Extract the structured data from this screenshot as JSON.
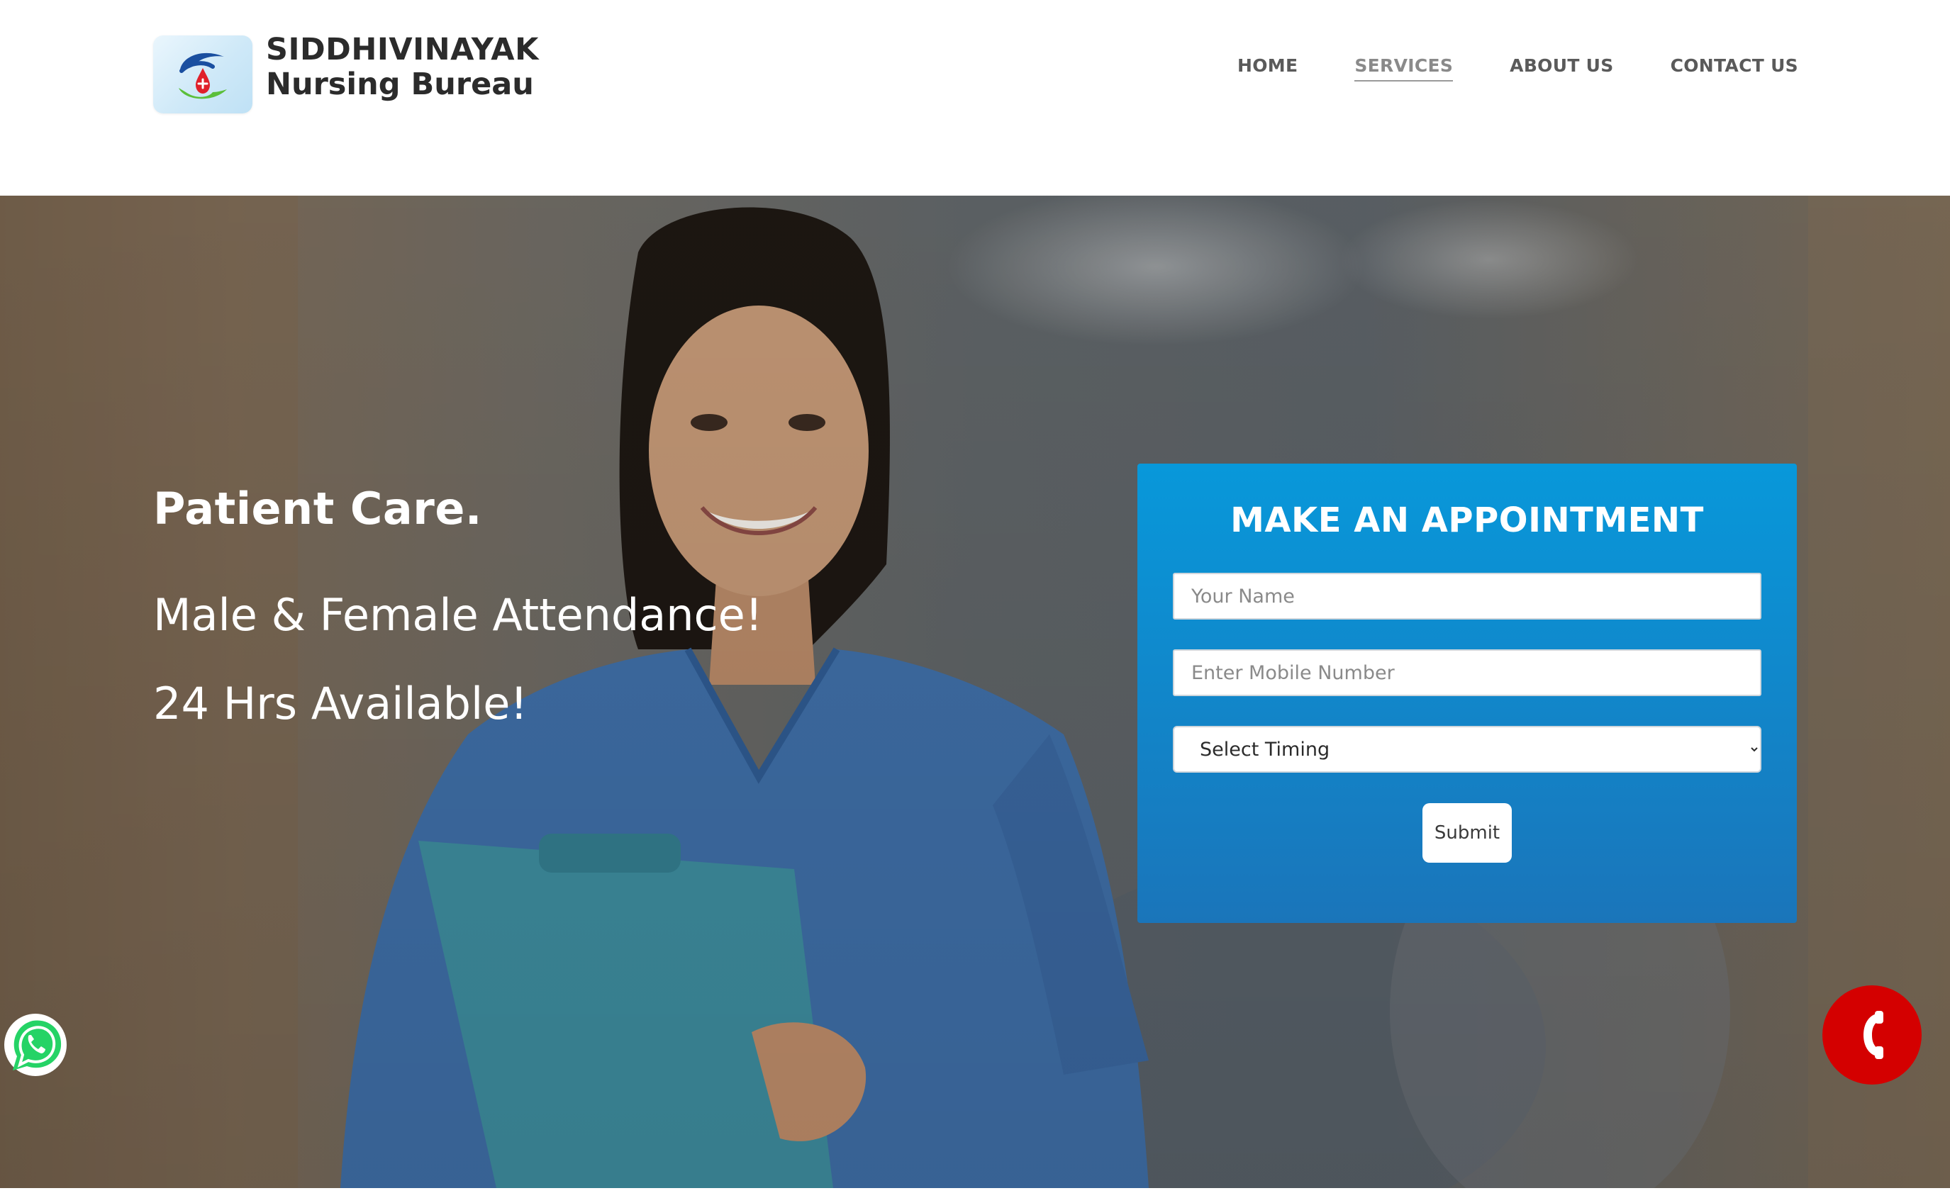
{
  "header": {
    "brand_line1": "SIDDHIVINAYAK",
    "brand_line2": "Nursing Bureau",
    "logo_icon": "hands-blood-drop-logo"
  },
  "nav": {
    "items": [
      {
        "label": "HOME",
        "active": false
      },
      {
        "label": "SERVICES",
        "active": true
      },
      {
        "label": "ABOUT US",
        "active": false
      },
      {
        "label": "CONTACT US",
        "active": false
      }
    ]
  },
  "hero": {
    "headline": "Patient Care.",
    "line1": "Male & Female Attendance!",
    "line2": "24 Hrs Available!"
  },
  "appointment": {
    "title": "MAKE AN APPOINTMENT",
    "name_placeholder": "Your Name",
    "mobile_placeholder": "Enter Mobile Number",
    "timing_selected": "Select Timing",
    "submit_label": "Submit"
  },
  "floating": {
    "whatsapp_icon": "whatsapp-icon",
    "call_icon": "phone-icon"
  },
  "colors": {
    "card_top": "#0898da",
    "card_bottom": "#1a75ba",
    "call_button": "#d40000",
    "whatsapp_green": "#25d366"
  }
}
